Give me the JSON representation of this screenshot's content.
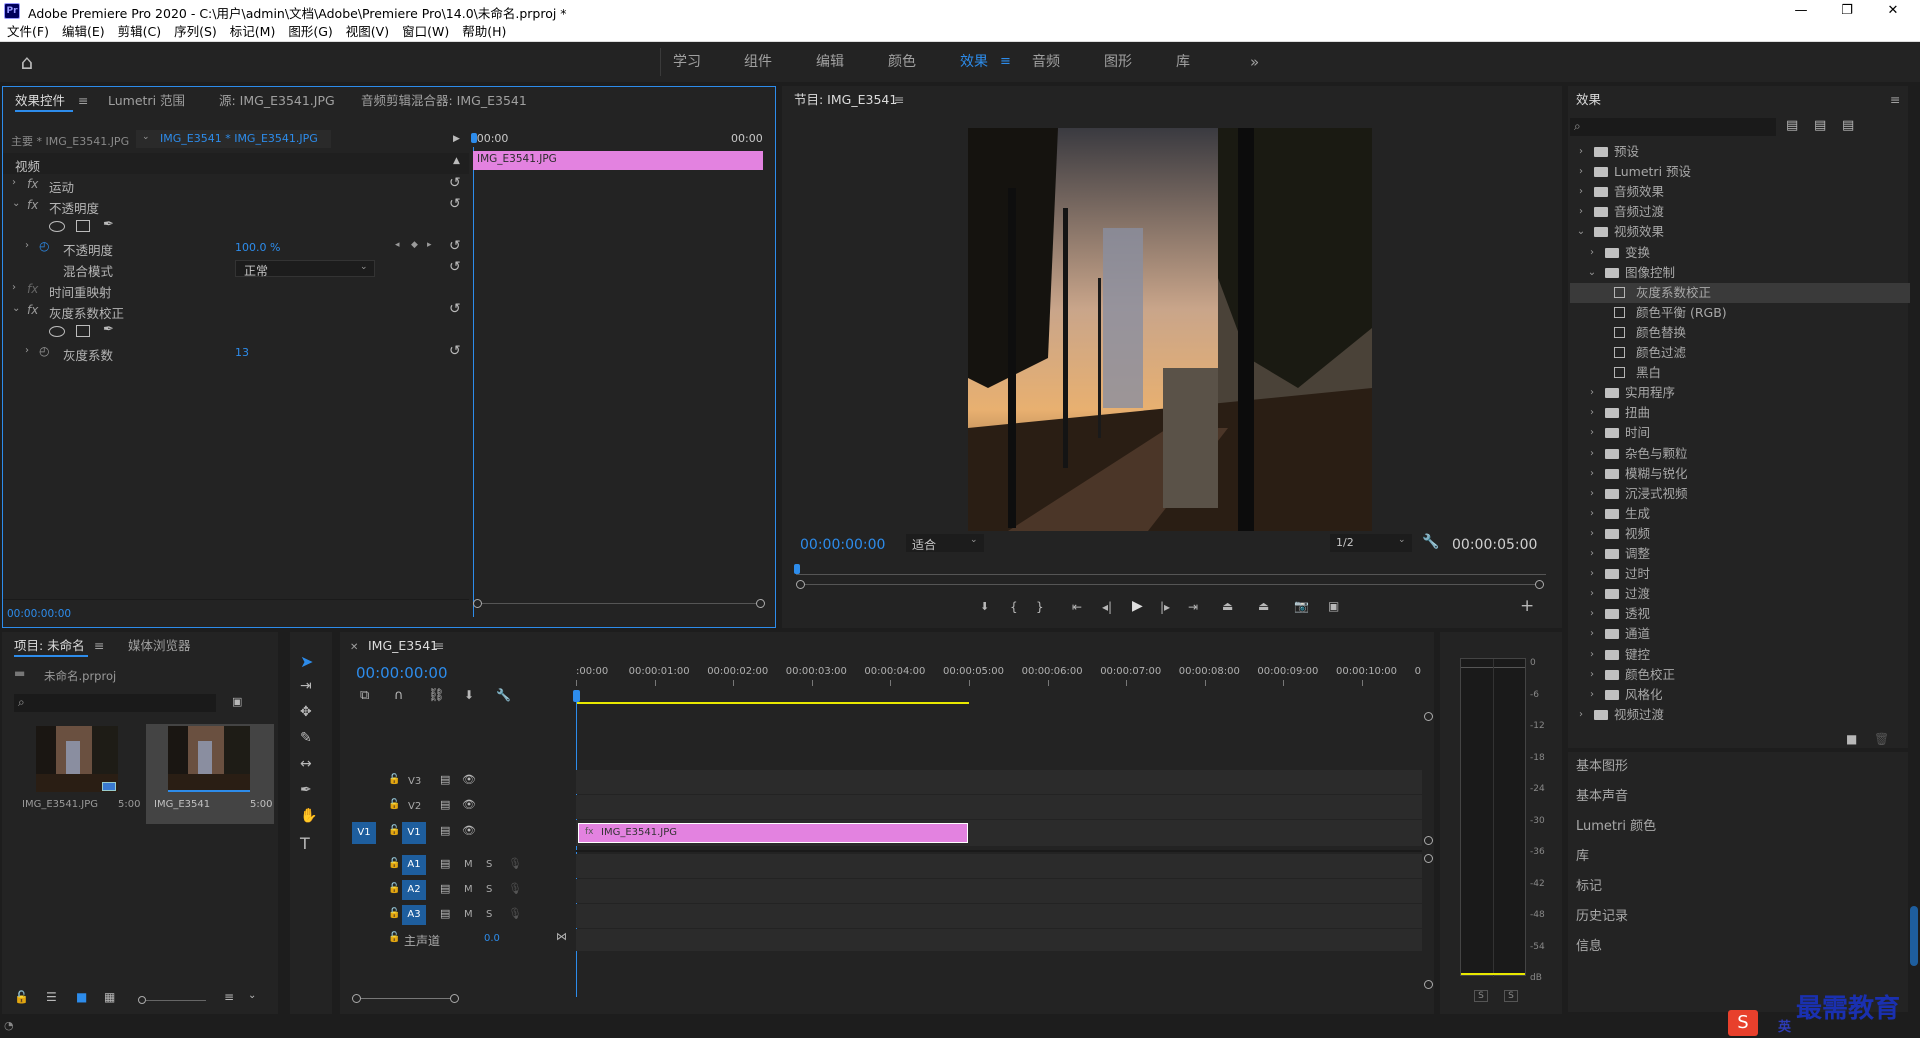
{
  "app": {
    "title": "Adobe Premiere Pro 2020 - C:\\用户\\admin\\文档\\Adobe\\Premiere Pro\\14.0\\未命名.prproj *",
    "logo": "Pr"
  },
  "menu": [
    "文件(F)",
    "编辑(E)",
    "剪辑(C)",
    "序列(S)",
    "标记(M)",
    "图形(G)",
    "视图(V)",
    "窗口(W)",
    "帮助(H)"
  ],
  "workspaces": [
    "学习",
    "组件",
    "编辑",
    "颜色",
    "效果",
    "音频",
    "图形",
    "库"
  ],
  "active_workspace": "效果",
  "effect_controls": {
    "tabs": [
      "效果控件",
      "Lumetri 范围",
      "源: IMG_E3541.JPG",
      "音频剪辑混合器: IMG_E3541"
    ],
    "master": "主要 * IMG_E3541.JPG",
    "clip_select": "IMG_E3541 * IMG_E3541.JPG",
    "time_start": ":00:00",
    "time_end": "00:00",
    "clip_bar": "IMG_E3541.JPG",
    "section_video": "视频",
    "motion": "运动",
    "opacity": "不透明度",
    "opacity_label": "不透明度",
    "opacity_value": "100.0 %",
    "blend_label": "混合模式",
    "blend_value": "正常",
    "time_remap": "时间重映射",
    "gamma": "灰度系数校正",
    "gamma_label": "灰度系数",
    "gamma_value": "13",
    "timecode": "00:00:00:00"
  },
  "program": {
    "title": "节目: IMG_E3541",
    "timecode_in": "00:00:00:00",
    "fit": "适合",
    "quality": "1/2",
    "timecode_out": "00:00:05:00"
  },
  "project": {
    "tabs": [
      "项目: 未命名",
      "媒体浏览器"
    ],
    "file": "未命名.prproj",
    "items": [
      {
        "name": "IMG_E3541.JPG",
        "dur": "5:00"
      },
      {
        "name": "IMG_E3541",
        "dur": "5:00"
      }
    ]
  },
  "timeline": {
    "tab": "IMG_E3541",
    "timecode": "00:00:00:00",
    "ruler": [
      ":00:00",
      "00:00:01:00",
      "00:00:02:00",
      "00:00:03:00",
      "00:00:04:00",
      "00:00:05:00",
      "00:00:06:00",
      "00:00:07:00",
      "00:00:08:00",
      "00:00:09:00",
      "00:00:10:00",
      "0"
    ],
    "video_tracks": [
      "V3",
      "V2",
      "V1"
    ],
    "audio_tracks": [
      "A1",
      "A2",
      "A3"
    ],
    "source_v1": "V1",
    "mute": "M",
    "solo": "S",
    "master_label": "主声道",
    "master_value": "0.0",
    "clip": "IMG_E3541.JPG"
  },
  "meter": {
    "scale": [
      "0",
      "-6",
      "-12",
      "-18",
      "-24",
      "-30",
      "-36",
      "-42",
      "-48",
      "-54",
      "dB"
    ],
    "solo_left": "S",
    "solo_right": "S"
  },
  "effects": {
    "title": "效果",
    "tree": [
      {
        "label": "预设",
        "level": 0,
        "type": "folder",
        "open": false
      },
      {
        "label": "Lumetri 预设",
        "level": 0,
        "type": "folder",
        "open": false
      },
      {
        "label": "音频效果",
        "level": 0,
        "type": "folder",
        "open": false
      },
      {
        "label": "音频过渡",
        "level": 0,
        "type": "folder",
        "open": false
      },
      {
        "label": "视频效果",
        "level": 0,
        "type": "folder",
        "open": true
      },
      {
        "label": "变换",
        "level": 1,
        "type": "folder",
        "open": false
      },
      {
        "label": "图像控制",
        "level": 1,
        "type": "folder",
        "open": true
      },
      {
        "label": "灰度系数校正",
        "level": 2,
        "type": "fx",
        "selected": true
      },
      {
        "label": "颜色平衡 (RGB)",
        "level": 2,
        "type": "fx"
      },
      {
        "label": "颜色替换",
        "level": 2,
        "type": "fx"
      },
      {
        "label": "颜色过滤",
        "level": 2,
        "type": "fx"
      },
      {
        "label": "黑白",
        "level": 2,
        "type": "fx"
      },
      {
        "label": "实用程序",
        "level": 1,
        "type": "folder",
        "open": false
      },
      {
        "label": "扭曲",
        "level": 1,
        "type": "folder",
        "open": false
      },
      {
        "label": "时间",
        "level": 1,
        "type": "folder",
        "open": false
      },
      {
        "label": "杂色与颗粒",
        "level": 1,
        "type": "folder",
        "open": false
      },
      {
        "label": "模糊与锐化",
        "level": 1,
        "type": "folder",
        "open": false
      },
      {
        "label": "沉浸式视频",
        "level": 1,
        "type": "folder",
        "open": false
      },
      {
        "label": "生成",
        "level": 1,
        "type": "folder",
        "open": false
      },
      {
        "label": "视频",
        "level": 1,
        "type": "folder",
        "open": false
      },
      {
        "label": "调整",
        "level": 1,
        "type": "folder",
        "open": false
      },
      {
        "label": "过时",
        "level": 1,
        "type": "folder",
        "open": false
      },
      {
        "label": "过渡",
        "level": 1,
        "type": "folder",
        "open": false
      },
      {
        "label": "透视",
        "level": 1,
        "type": "folder",
        "open": false
      },
      {
        "label": "通道",
        "level": 1,
        "type": "folder",
        "open": false
      },
      {
        "label": "键控",
        "level": 1,
        "type": "folder",
        "open": false
      },
      {
        "label": "颜色校正",
        "level": 1,
        "type": "folder",
        "open": false
      },
      {
        "label": "风格化",
        "level": 1,
        "type": "folder",
        "open": false
      },
      {
        "label": "视频过渡",
        "level": 0,
        "type": "folder",
        "open": false
      }
    ],
    "side_panels": [
      "基本图形",
      "基本声音",
      "Lumetri 颜色",
      "库",
      "标记",
      "历史记录",
      "信息"
    ]
  },
  "watermark": {
    "text": "最需教育",
    "ime": "英"
  },
  "colors": {
    "accent": "#2d8ceb",
    "clip": "#e382e0",
    "work_area": "#e8e800"
  }
}
